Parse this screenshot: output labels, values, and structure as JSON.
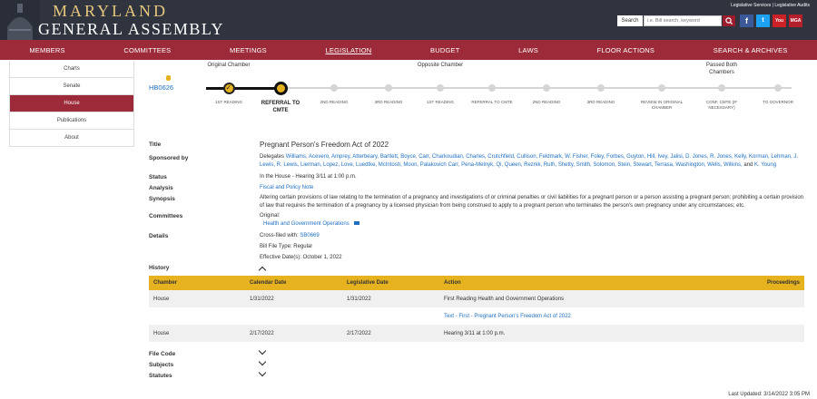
{
  "header": {
    "logo_line1": "MARYLAND",
    "logo_line2": "GENERAL ASSEMBLY",
    "top_links": "Legislative Services | Legislative Audits",
    "search_label": "Search",
    "search_placeholder": "i.e. Bill search, keyword",
    "social_icons": [
      "facebook-icon",
      "twitter-icon",
      "youtube-icon",
      "mga-icon"
    ]
  },
  "nav": [
    "MEMBERS",
    "COMMITTEES",
    "MEETINGS",
    "LEGISLATION",
    "BUDGET",
    "LAWS",
    "FLOOR ACTIONS",
    "SEARCH & ARCHIVES"
  ],
  "nav_active": "LEGISLATION",
  "sidebar": [
    "Charts",
    "Senate",
    "House",
    "Publications",
    "About"
  ],
  "sidebar_selected": "House",
  "bill_number": "HB0626",
  "progress": {
    "groups": [
      {
        "label": "Original Chamber"
      },
      {
        "label": "Opposite Chamber"
      },
      {
        "label": "Passed Both Chambers"
      }
    ],
    "stages": [
      {
        "label": "1ST READING",
        "state": "done"
      },
      {
        "label": "REFERRAL TO CMTE",
        "state": "current"
      },
      {
        "label": "2ND READING",
        "state": "todo"
      },
      {
        "label": "3RD READING",
        "state": "todo"
      },
      {
        "label": "1ST READING",
        "state": "todo"
      },
      {
        "label": "REFERRAL TO CMTE",
        "state": "todo"
      },
      {
        "label": "2ND READING",
        "state": "todo"
      },
      {
        "label": "3RD READING",
        "state": "todo"
      },
      {
        "label": "REVIEW IN ORIGINAL CHAMBER",
        "state": "todo"
      },
      {
        "label": "CONF. CMTE (IF NECESSARY)",
        "state": "todo"
      },
      {
        "label": "TO GOVERNOR",
        "state": "todo"
      }
    ]
  },
  "details": {
    "title_label": "Title",
    "title": "Pregnant Person's Freedom Act of 2022",
    "sponsored_label": "Sponsored by",
    "sponsors_prefix": "Delegates",
    "sponsors": "Williams, Acevero, Amprey, Atterbeary, Bartlett, Boyce, Carr, Charkoudian, Charles, Crutchfield, Cullison, Feldmark, W. Fisher, Foley, Forbes, Guyton, Hill, Ivey, Jalisi, D. Jones, R. Jones, Kelly, Korman, Lehman, J. Lewis, R. Lewis, Lierman, Lopez, Love, Luedtke, McIntosh, Moon, Palakovich Carr, Pena-Melnyk, Qi, Queen, Reznik, Ruth, Shetty, Smith, Solomon, Stein, Stewart, Terrasa, Washington, Wells, Wilkins,",
    "sponsors_and": "and",
    "sponsors_last": "K. Young",
    "status_label": "Status",
    "status": "In the House - Hearing 3/11 at 1:00 p.m.",
    "analysis_label": "Analysis",
    "analysis": "Fiscal and Policy Note",
    "synopsis_label": "Synopsis",
    "synopsis": "Altering certain provisions of law relating to the termination of a pregnancy and investigations of or criminal penalties or civil liabilities for a pregnant person or a person assisting a pregnant person; prohibiting a certain provision of law that requires the termination of a pregnancy by a licensed physician from being construed to apply to a pregnant person who terminates the person's own pregnancy under any circumstances; etc.",
    "committees_label": "Committees",
    "committees_original": "Original:",
    "committee": "Health and Government Operations",
    "details_label": "Details",
    "crossfiled_prefix": "Cross-filed with:",
    "crossfiled": "SB0669",
    "bill_file_type": "Bill File Type: Regular",
    "effective": "Effective Date(s): October 1, 2022"
  },
  "history": {
    "label": "History",
    "headers": [
      "Chamber",
      "Calendar Date",
      "Legislative Date",
      "Action",
      "Proceedings"
    ],
    "rows": [
      {
        "chamber": "House",
        "calendar": "1/31/2022",
        "legislative": "1/31/2022",
        "action": "First Reading Health and Government Operations"
      },
      {
        "chamber": "",
        "calendar": "",
        "legislative": "",
        "action": "Text - First - Pregnant Person's Freedom Act of 2022"
      },
      {
        "chamber": "House",
        "calendar": "2/17/2022",
        "legislative": "2/17/2022",
        "action": "Hearing 3/11 at 1:00 p.m."
      }
    ]
  },
  "collapsibles": [
    "File Code",
    "Subjects",
    "Statutes"
  ],
  "last_updated": "Last Updated: 3/14/2022 3:05 PM"
}
